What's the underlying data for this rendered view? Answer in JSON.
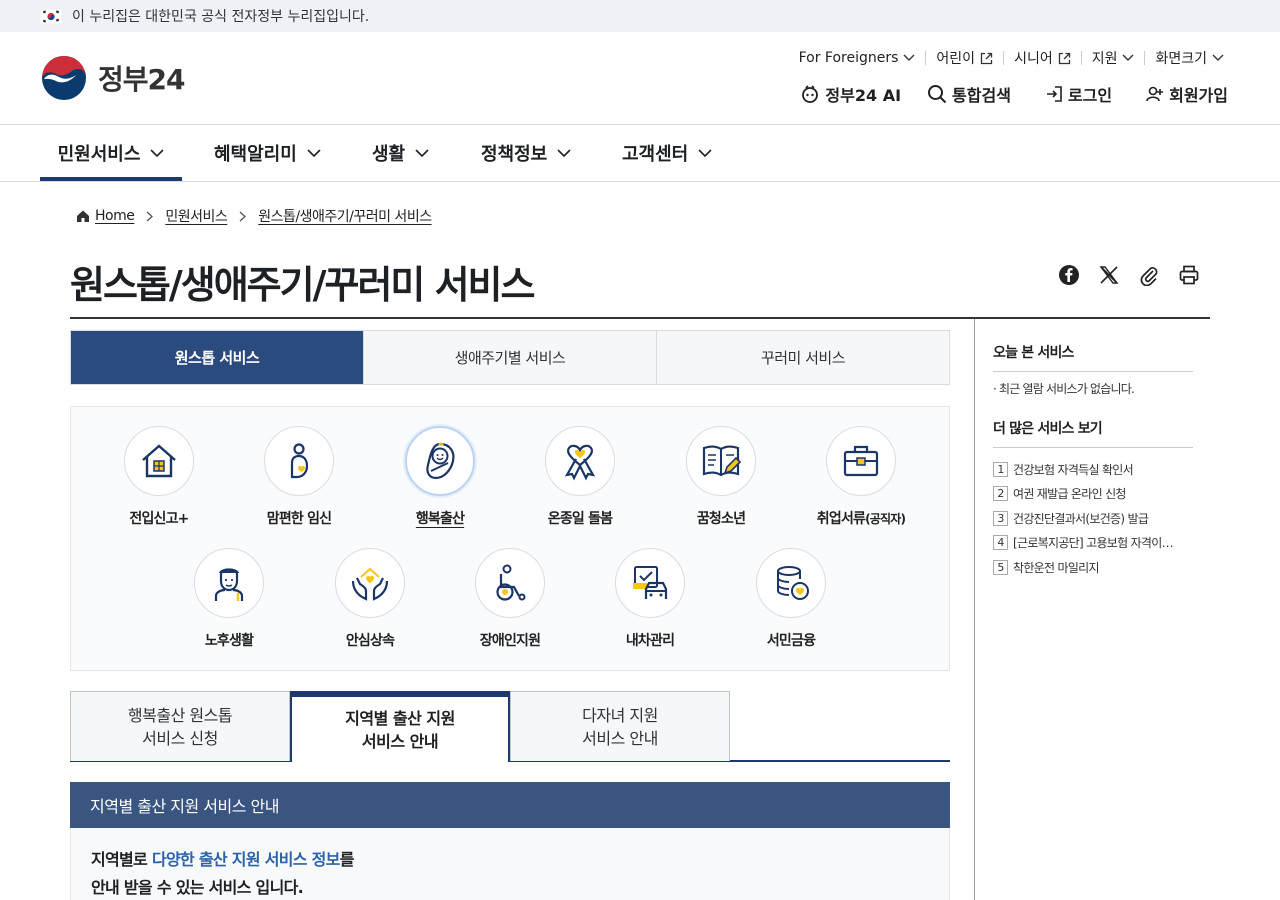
{
  "gov_banner": {
    "text": "이 누리집은 대한민국 공식 전자정부 누리집입니다."
  },
  "logo": {
    "text": "정부24"
  },
  "util_nav": {
    "foreigners": "For Foreigners",
    "kids": "어린이",
    "senior": "시니어",
    "support": "지원",
    "font_size": "화면크기"
  },
  "main_util": {
    "ai": "정부24 AI",
    "search": "통합검색",
    "login": "로그인",
    "signup": "회원가입"
  },
  "gnb": [
    "민원서비스",
    "혜택알리미",
    "생활",
    "정책정보",
    "고객센터"
  ],
  "breadcrumb": [
    "Home",
    "민원서비스",
    "원스톱/생애주기/꾸러미 서비스"
  ],
  "page_title": "원스톱/생애주기/꾸러미 서비스",
  "tabs": [
    "원스톱 서비스",
    "생애주기별 서비스",
    "꾸러미 서비스"
  ],
  "services": {
    "s1": "전입신고+",
    "s2": "맘편한 임신",
    "s3": "행복출산",
    "s4": "온종일 돌봄",
    "s5": "꿈청소년",
    "s6_main": "취업서류",
    "s6_sub": "(공직자)",
    "s7": "노후생활",
    "s8": "안심상속",
    "s9": "장애인지원",
    "s10": "내차관리",
    "s11": "서민금융"
  },
  "sub_tabs": {
    "t1_l1": "행복출산 원스톱",
    "t1_l2": "서비스 신청",
    "t2_l1": "지역별 출산 지원",
    "t2_l2": "서비스 안내",
    "t3_l1": "다자녀 지원",
    "t3_l2": "서비스 안내"
  },
  "section": {
    "head": "지역별 출산 지원 서비스 안내",
    "line1_a": "지역별로 ",
    "line1_hl": "다양한 출산 지원 서비스 정보",
    "line1_b": "를",
    "line2": "안내 받을 수 있는 서비스 입니다."
  },
  "sidebar": {
    "recent_title": "오늘 본 서비스",
    "recent_empty": "최근 열람 서비스가 없습니다.",
    "more_title": "더 많은 서비스 보기",
    "items": [
      {
        "num": "1",
        "label": "건강보험 자격득실 확인서"
      },
      {
        "num": "2",
        "label": "여권 재발급 온라인 신청"
      },
      {
        "num": "3",
        "label": "건강진단결과서(보건증) 발급"
      },
      {
        "num": "4",
        "label": "[근로복지공단] 고용보험 자격이…"
      },
      {
        "num": "5",
        "label": "착한운전 마일리지"
      }
    ]
  },
  "colors": {
    "primary": "#2b4a7e",
    "section_head": "#3a5580",
    "accent": "#f5c518",
    "highlight": "#2c62a8"
  }
}
